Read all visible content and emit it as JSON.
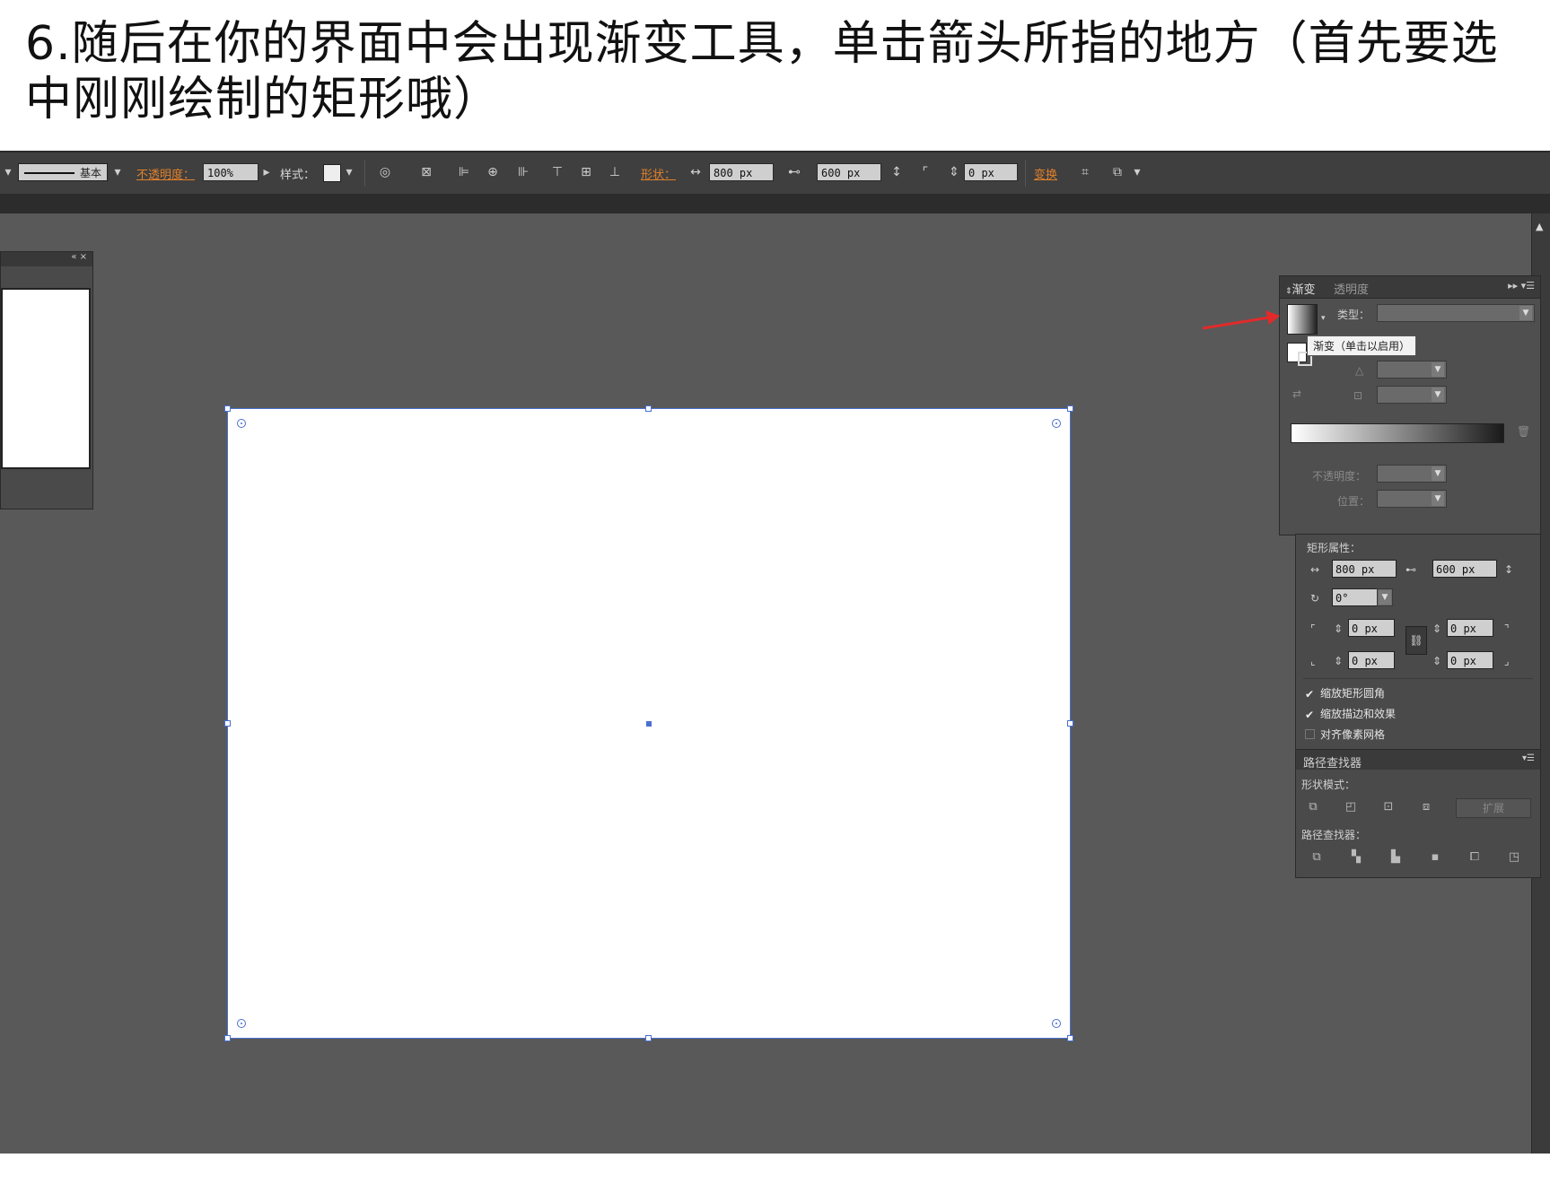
{
  "caption": {
    "line1": "6.随后在你的界面中会出现渐变工具，单击箭头所指的地方（首先要选",
    "line2": "中刚刚绘制的矩形哦）"
  },
  "toolbar": {
    "stroke_profile": "基本",
    "opacity_label": "不透明度：",
    "opacity_value": "100%",
    "style_label": "样式：",
    "shape_label": "形状：",
    "width_value": "800 px",
    "height_value": "600 px",
    "corner_value": "0 px",
    "transform_label": "变换"
  },
  "gradient_panel": {
    "tab_active": "渐变",
    "tab_inactive": "透明度",
    "type_label": "类型：",
    "tooltip": "渐变（单击以启用）",
    "opacity_label": "不透明度：",
    "position_label": "位置："
  },
  "rect_panel": {
    "title": "矩形属性：",
    "width": "800 px",
    "height": "600 px",
    "angle": "0°",
    "corner_tl": "0 px",
    "corner_tr": "0 px",
    "corner_bl": "0 px",
    "corner_br": "0 px",
    "cb_scale_corners": "缩放矩形圆角",
    "cb_scale_strokes": "缩放描边和效果",
    "cb_align_pixel": "对齐像素网格"
  },
  "pathfinder": {
    "title": "路径查找器",
    "shape_modes_label": "形状模式：",
    "expand": "扩展",
    "pathfinders_label": "路径查找器："
  },
  "colors": {
    "canvas_bg": "#595959",
    "selection": "#4a6fd0",
    "accent_orange": "#e0802a",
    "arrow_red": "#e22a2a"
  }
}
